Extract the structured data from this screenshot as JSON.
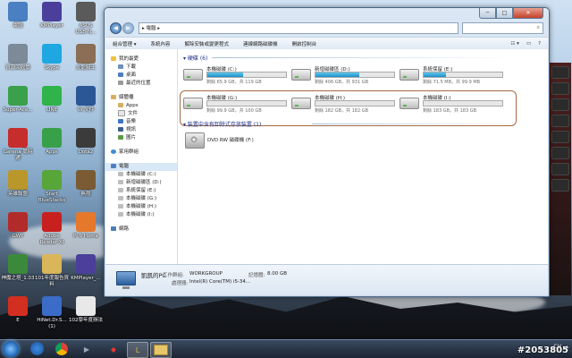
{
  "desktop": {
    "icons": [
      {
        "label": "電腦",
        "color": "#4a7fc1",
        "glyph": "computer-icon"
      },
      {
        "label": "KMPlayer",
        "color": "#4b3f9b",
        "glyph": "kmplayer-icon"
      },
      {
        "label": "ASUS\nUSB-N...",
        "color": "#5a5a5a",
        "glyph": "usb-adapter-icon"
      },
      {
        "label": "資源回收筒",
        "color": "#7d8a98",
        "glyph": "recycle-bin-icon"
      },
      {
        "label": "Skype",
        "color": "#1fa7e1",
        "glyph": "skype-icon"
      },
      {
        "label": "炎龍騎士",
        "color": "#8a6e55",
        "glyph": "game-icon"
      },
      {
        "label": "Super-Ace...",
        "color": "#3aa04b",
        "glyph": "game-icon"
      },
      {
        "label": "LINE",
        "color": "#2fb34a",
        "glyph": "line-icon"
      },
      {
        "label": "W 文件",
        "color": "#2b5797",
        "glyph": "word-icon"
      },
      {
        "label": "Garena 競時通",
        "color": "#c62d2d",
        "glyph": "garena-icon"
      },
      {
        "label": "Apps",
        "color": "#39a04a",
        "glyph": "apps-icon"
      },
      {
        "label": "Dota2",
        "color": "#3b3b3b",
        "glyph": "game-icon"
      },
      {
        "label": "英雄聯盟",
        "color": "#b9972b",
        "glyph": "lol-icon"
      },
      {
        "label": "Start BlueStacks",
        "color": "#58a53a",
        "glyph": "bluestacks-icon"
      },
      {
        "label": "無限",
        "color": "#7a5b33",
        "glyph": "game-icon"
      },
      {
        "label": "GWT",
        "color": "#b22b2b",
        "glyph": "game-icon"
      },
      {
        "label": "Adobe Reader XI",
        "color": "#c8201e",
        "glyph": "adobe-reader-icon"
      },
      {
        "label": "Pi 9 Home",
        "color": "#e6782c",
        "glyph": "app-icon"
      },
      {
        "label": "神魔之塔_1.03",
        "color": "#3b8a3b",
        "glyph": "game-icon"
      },
      {
        "label": "101年度報告資料",
        "color": "#d9b65a",
        "glyph": "folder-icon"
      },
      {
        "label": "KMPlayer_...",
        "color": "#4b3f9b",
        "glyph": "kmplayer-icon"
      },
      {
        "label": "E",
        "color": "#d22f21",
        "glyph": "flash-icon"
      },
      {
        "label": "HiNet.Dr.S...(1)",
        "color": "#3b6cc7",
        "glyph": "app-icon"
      },
      {
        "label": "102學年度辦法",
        "color": "#e8e8e8",
        "glyph": "document-icon"
      }
    ]
  },
  "window": {
    "nav_back": "◀",
    "nav_forward": "▶",
    "address": "▸ 電腦 ▸",
    "search_icon": "⌕",
    "buttons": {
      "min": "─",
      "max": "□",
      "close": "✕"
    },
    "commands": [
      "組合管理 ▾",
      "系統內容",
      "解除安裝或變更程式",
      "連線網路磁碟機",
      "開啟控制台"
    ],
    "cmd_right": [
      "☷ ▾",
      "▭",
      "?"
    ],
    "nav": {
      "favorites_header": "我的最愛",
      "favorites": [
        "下載",
        "桌面",
        "最近的位置"
      ],
      "libraries_header": "媒體櫃",
      "libraries": [
        "Apps",
        "文件",
        "音樂",
        "視訊",
        "圖片"
      ],
      "homegroup": "家用群組",
      "computer_header": "電腦",
      "computer_items": [
        "本機磁碟 (C:)",
        "新增磁碟區 (D:)",
        "系統保留 (E:)",
        "本機磁碟 (G:)",
        "本機磁碟 (H:)",
        "本機磁碟 (I:)"
      ],
      "network": "網路"
    },
    "group_hdd": "▾ 硬碟 (6)",
    "group_removable": "▾ 裝置中含有卸除式存放裝置 (1)",
    "drives": [
      {
        "name": "本機磁碟 (C:)",
        "free": "剩餘 65.9 GB，共 119 GB",
        "used": 0.45
      },
      {
        "name": "新增磁碟區 (D:)",
        "free": "剩餘 406 GB，共 931 GB",
        "used": 0.56
      },
      {
        "name": "系統保留 (E:)",
        "free": "剩餘 71.5 MB，共 99.9 MB",
        "used": 0.28
      },
      {
        "name": "本機磁碟 (G:)",
        "free": "剩餘 99.9 GB，共 100 GB",
        "used": 0.0
      },
      {
        "name": "本機磁碟 (H:)",
        "free": "剩餘 182 GB，共 182 GB",
        "used": 0.0
      },
      {
        "name": "本機磁碟 (I:)",
        "free": "剩餘 183 GB，共 183 GB",
        "used": 0.0
      }
    ],
    "dvd": "DVD RW 磁碟機 (F:)",
    "details": {
      "pc_name": "凱凱的PC",
      "workgroup_label": "工作群組:",
      "workgroup": "WORKGROUP",
      "memory_label": "記憶體:",
      "memory": "8.00 GB",
      "processor_label": "處理器:",
      "processor": "Intel(R) Core(TM) i5-34..."
    }
  },
  "taskbar": {
    "lang": "CH",
    "watermark": "#2053805"
  }
}
